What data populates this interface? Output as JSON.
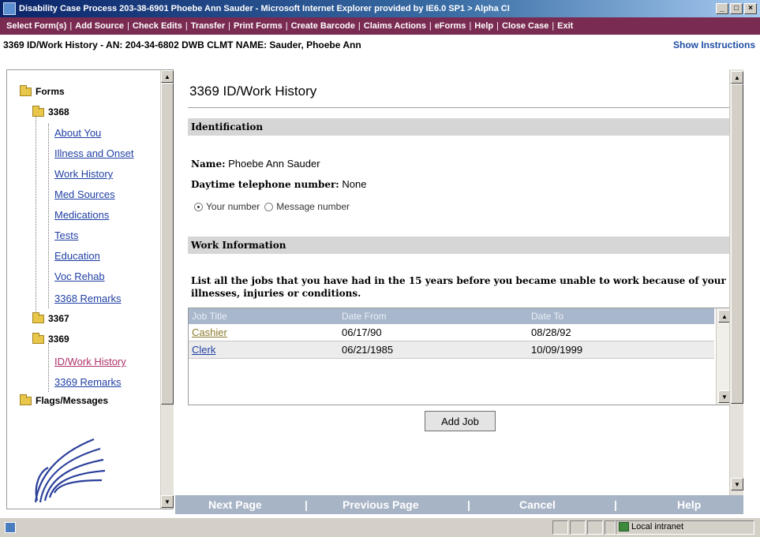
{
  "window": {
    "title": "Disability Case Process 203-38-6901 Phoebe Ann Sauder - Microsoft Internet Explorer provided by IE6.0 SP1 > Alpha CI",
    "min_label": "_",
    "max_label": "□",
    "close_label": "×"
  },
  "menu": {
    "items": [
      "Select Form(s)",
      "Add Source",
      "Check Edits",
      "Transfer",
      "Print Forms",
      "Create Barcode",
      "Claims Actions",
      "eForms",
      "Help",
      "Close Case",
      "Exit"
    ],
    "separator": "|"
  },
  "header": {
    "case_title": "3369 ID/Work History - AN: 204-34-6802 DWB CLMT NAME: Sauder, Phoebe Ann",
    "show_instructions": "Show Instructions"
  },
  "tree": {
    "forms_label": "Forms",
    "group_3368": "3368",
    "items_3368": [
      "About You",
      "Illness and Onset",
      "Work History",
      "Med Sources",
      "Medications",
      "Tests",
      "Education",
      "Voc Rehab",
      "3368 Remarks"
    ],
    "group_3367": "3367",
    "group_3369": "3369",
    "items_3369": [
      "ID/Work History",
      "3369 Remarks"
    ],
    "flags_label": "Flags/Messages"
  },
  "main": {
    "page_title": "3369 ID/Work History",
    "identification_header": "Identification",
    "name_label": "Name:",
    "name_value": "Phoebe Ann Sauder",
    "phone_label": "Daytime telephone number:",
    "phone_value": "None",
    "radio_your_number": "Your number",
    "radio_message_number": "Message number",
    "work_info_header": "Work Information",
    "instructions": "List all the jobs that you have had in the 15 years before you became unable to work because of your illnesses, injuries or conditions.",
    "table": {
      "headers": [
        "Job Title",
        "Date From",
        "Date To"
      ],
      "rows": [
        {
          "title": "Cashier",
          "from": "06/17/90",
          "to": "08/28/92"
        },
        {
          "title": "Clerk",
          "from": "06/21/1985",
          "to": "10/09/1999"
        }
      ]
    },
    "add_job_button": "Add Job"
  },
  "footer_nav": {
    "next_page": "Next Page",
    "previous_page": "Previous Page",
    "cancel": "Cancel",
    "help": "Help",
    "separator": "|"
  },
  "status": {
    "zone": "Local intranet"
  }
}
